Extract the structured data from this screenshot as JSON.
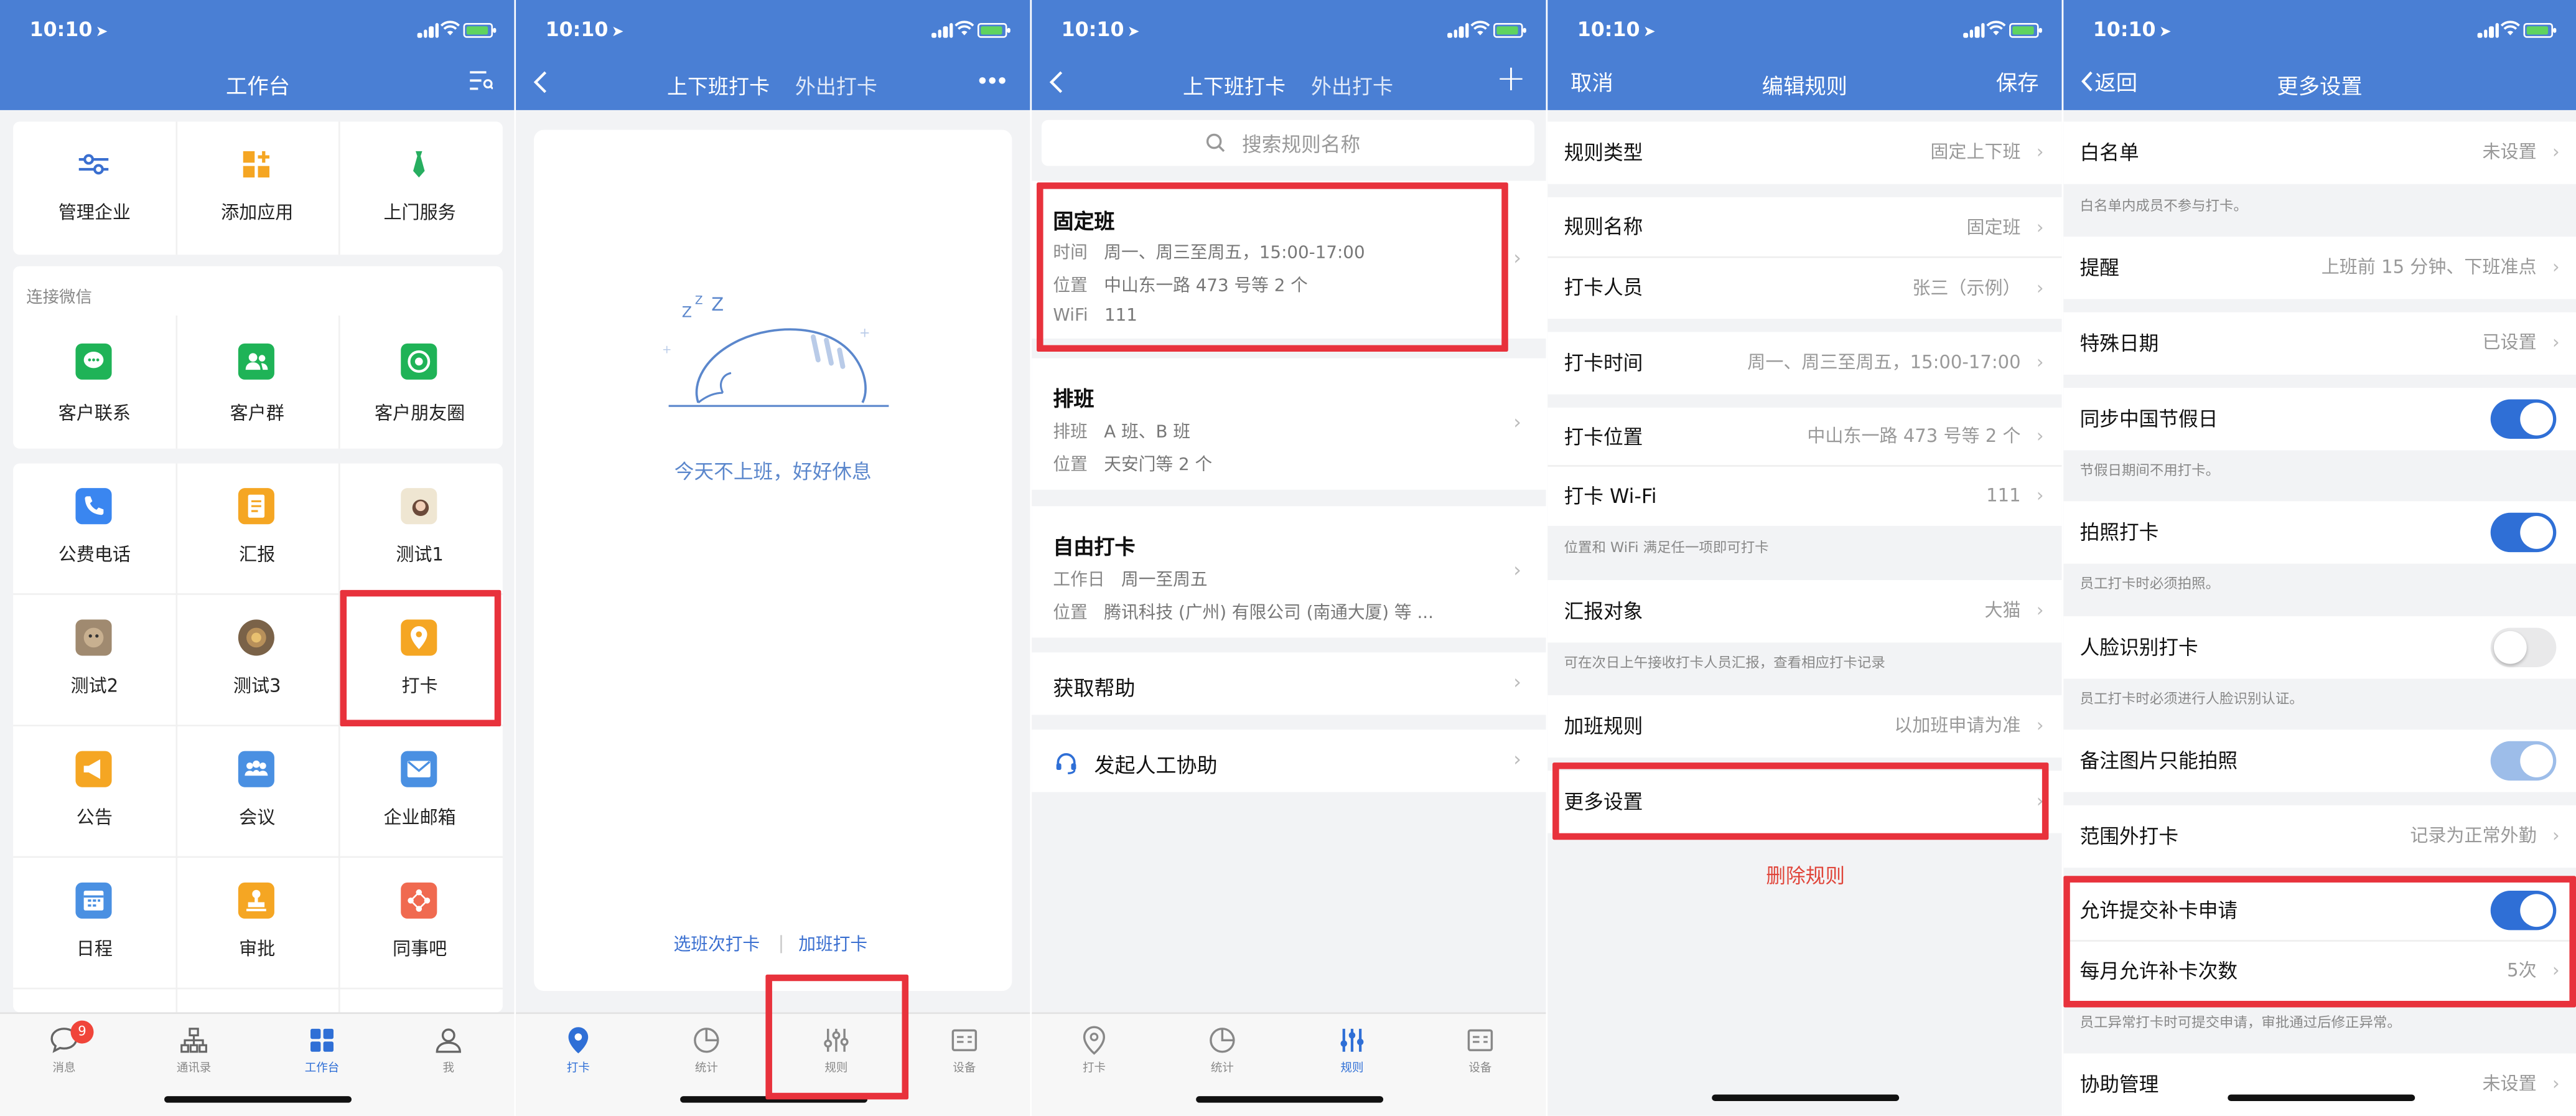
{
  "status_bar": {
    "time": "10:10"
  },
  "colors": {
    "header_blue": "#4a7fd4",
    "accent_blue": "#2f6fd6",
    "highlight_red": "#e8323c",
    "danger_text": "#e0453a"
  },
  "screen1": {
    "title": "工作台",
    "top_items": [
      {
        "label": "管理企业",
        "icon": "sliders-icon",
        "color": "#3a6fd0"
      },
      {
        "label": "添加应用",
        "icon": "add-app-icon",
        "color": "#f5a623"
      },
      {
        "label": "上门服务",
        "icon": "tie-icon",
        "color": "#27ae60"
      }
    ],
    "wechat_section_title": "连接微信",
    "wechat_items": [
      {
        "label": "客户联系",
        "icon": "chat-bubble-icon",
        "color": "#1fb357"
      },
      {
        "label": "客户群",
        "icon": "group-icon",
        "color": "#1fb357"
      },
      {
        "label": "客户朋友圈",
        "icon": "aperture-icon",
        "color": "#1fb357"
      }
    ],
    "apps": [
      {
        "label": "公费电话",
        "icon": "phone-icon",
        "color": "#3a86f0"
      },
      {
        "label": "汇报",
        "icon": "report-icon",
        "color": "#f5a623"
      },
      {
        "label": "测试1",
        "icon": "avatar-icon",
        "color": "#e8ddc6"
      },
      {
        "label": "测试2",
        "icon": "avatar-icon",
        "color": "#b09a80"
      },
      {
        "label": "测试3",
        "icon": "avatar-icon",
        "color": "#8a7050"
      },
      {
        "label": "打卡",
        "icon": "location-pin-icon",
        "color": "#f5a623"
      },
      {
        "label": "公告",
        "icon": "megaphone-icon",
        "color": "#f5a623"
      },
      {
        "label": "会议",
        "icon": "meeting-icon",
        "color": "#4a90e2"
      },
      {
        "label": "企业邮箱",
        "icon": "mail-icon",
        "color": "#4a90e2"
      },
      {
        "label": "日程",
        "icon": "calendar-icon",
        "color": "#4a90e2"
      },
      {
        "label": "审批",
        "icon": "stamp-icon",
        "color": "#f5a623"
      },
      {
        "label": "同事吧",
        "icon": "share-icon",
        "color": "#f06a50"
      }
    ],
    "tabs": [
      {
        "label": "消息",
        "icon": "message-icon",
        "badge": "9"
      },
      {
        "label": "通讯录",
        "icon": "org-chart-icon"
      },
      {
        "label": "工作台",
        "icon": "workbench-icon"
      },
      {
        "label": "我",
        "icon": "person-icon"
      }
    ]
  },
  "screen2": {
    "tab_active": "上下班打卡",
    "tab_other": "外出打卡",
    "rest_message": "今天不上班，好好休息",
    "link_optional": "选班次打卡",
    "link_overtime": "加班打卡",
    "tabs": [
      {
        "label": "打卡",
        "icon": "location-pin-icon"
      },
      {
        "label": "统计",
        "icon": "pie-chart-icon"
      },
      {
        "label": "规则",
        "icon": "sliders-icon"
      },
      {
        "label": "设备",
        "icon": "device-icon"
      }
    ]
  },
  "screen3": {
    "tab_active": "上下班打卡",
    "tab_other": "外出打卡",
    "add_label": "+",
    "search_placeholder": "搜索规则名称",
    "rules": [
      {
        "title": "固定班",
        "lines": [
          {
            "k": "时间",
            "v": "周一、周三至周五，15:00-17:00"
          },
          {
            "k": "位置",
            "v": "中山东一路 473 号等 2 个"
          },
          {
            "k": "WiFi",
            "v": "111"
          }
        ]
      },
      {
        "title": "排班",
        "lines": [
          {
            "k": "排班",
            "v": "A 班、B 班"
          },
          {
            "k": "位置",
            "v": "天安门等 2 个"
          }
        ]
      },
      {
        "title": "自由打卡",
        "lines": [
          {
            "k": "工作日",
            "v": "周一至周五"
          },
          {
            "k": "位置",
            "v": "腾讯科技 (广州) 有限公司 (南通大厦) 等 ..."
          }
        ]
      }
    ],
    "help": "获取帮助",
    "assist": "发起人工协助",
    "tabs": [
      {
        "label": "打卡",
        "icon": "location-pin-icon"
      },
      {
        "label": "统计",
        "icon": "pie-chart-icon"
      },
      {
        "label": "规则",
        "icon": "sliders-icon"
      },
      {
        "label": "设备",
        "icon": "device-icon"
      }
    ]
  },
  "screen4": {
    "cancel": "取消",
    "title": "编辑规则",
    "save": "保存",
    "rows": [
      {
        "k": "规则类型",
        "v": "固定上下班"
      },
      {
        "k": "规则名称",
        "v": "固定班"
      },
      {
        "k": "打卡人员",
        "v": "张三（示例）"
      },
      {
        "k": "打卡时间",
        "v": "周一、周三至周五，15:00-17:00"
      },
      {
        "k": "打卡位置",
        "v": "中山东一路 473 号等 2 个"
      },
      {
        "k": "打卡 Wi-Fi",
        "v": "111"
      },
      {
        "k": "汇报对象",
        "v": "大猫"
      },
      {
        "k": "加班规则",
        "v": "以加班申请为准"
      },
      {
        "k": "更多设置",
        "v": ""
      }
    ],
    "note_location": "位置和 WiFi 满足任一项即可打卡",
    "note_report": "可在次日上午接收打卡人员汇报，查看相应打卡记录",
    "delete": "删除规则"
  },
  "screen5": {
    "back": "返回",
    "title": "更多设置",
    "rows": {
      "whitelist": {
        "k": "白名单",
        "v": "未设置"
      },
      "reminder": {
        "k": "提醒",
        "v": "上班前 15 分钟、下班准点"
      },
      "special_dates": {
        "k": "特殊日期",
        "v": "已设置"
      },
      "sync_holiday": {
        "k": "同步中国节假日",
        "on": true
      },
      "photo_checkin": {
        "k": "拍照打卡",
        "on": true
      },
      "face_checkin": {
        "k": "人脸识别打卡",
        "on": false
      },
      "photo_only": {
        "k": "备注图片只能拍照",
        "on": true
      },
      "out_of_range": {
        "k": "范围外打卡",
        "v": "记录为正常外勤"
      },
      "allow_makeup": {
        "k": "允许提交补卡申请",
        "on": true
      },
      "makeup_count": {
        "k": "每月允许补卡次数",
        "v": "5次"
      },
      "assist_manage": {
        "k": "协助管理",
        "v": "未设置"
      }
    },
    "notes": {
      "whitelist": "白名单内成员不参与打卡。",
      "holiday": "节假日期间不用打卡。",
      "photo": "员工打卡时必须拍照。",
      "face": "员工打卡时必须进行人脸识别认证。",
      "makeup": "员工异常打卡时可提交申请，审批通过后修正异常。"
    }
  }
}
